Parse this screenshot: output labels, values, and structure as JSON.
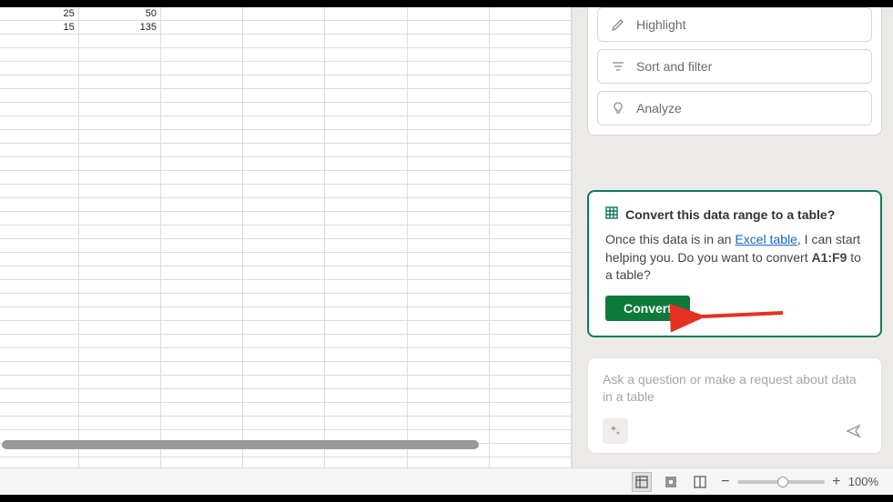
{
  "sheet": {
    "rows": [
      {
        "a": "25",
        "b": "50"
      },
      {
        "a": "15",
        "b": "135"
      }
    ]
  },
  "actions": {
    "highlight": "Highlight",
    "sort_filter": "Sort and filter",
    "analyze": "Analyze"
  },
  "prompt": {
    "title": "Convert this data range to a table?",
    "text_prefix": "Once this data is in an ",
    "link_text": "Excel table",
    "text_mid": ", I can start helping you. Do you want to convert ",
    "range": "A1:F9",
    "text_suffix": " to a table?",
    "button": "Convert"
  },
  "chat": {
    "placeholder": "Ask a question or make a request about data in a table"
  },
  "statusbar": {
    "zoom": "100%"
  }
}
